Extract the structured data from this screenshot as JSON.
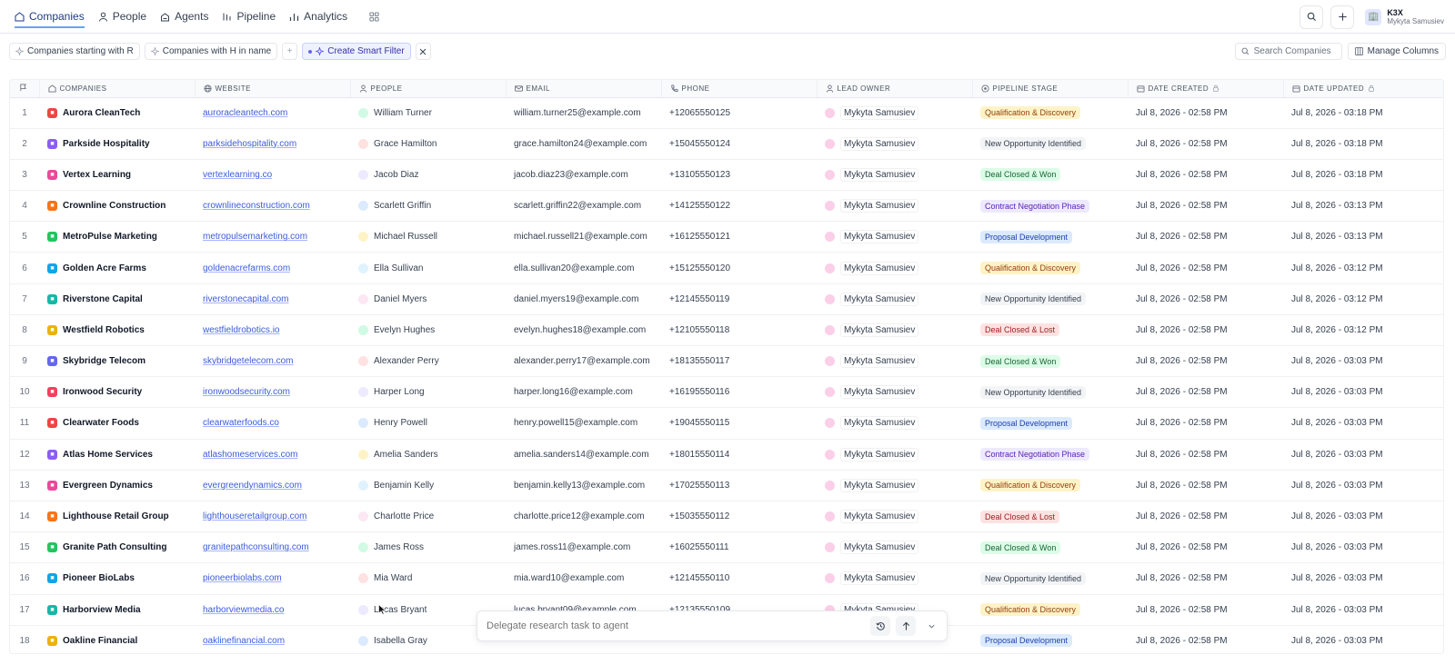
{
  "nav": {
    "items": [
      {
        "label": "Companies",
        "icon": "building-icon",
        "active": true
      },
      {
        "label": "People",
        "icon": "person-icon",
        "active": false
      },
      {
        "label": "Agents",
        "icon": "agent-icon",
        "active": false
      },
      {
        "label": "Pipeline",
        "icon": "pipeline-icon",
        "active": false
      },
      {
        "label": "Analytics",
        "icon": "chart-icon",
        "active": false
      }
    ]
  },
  "user": {
    "org": "K3X",
    "name": "Mykyta Samusiev"
  },
  "filters": {
    "chips": [
      "Companies starting with R",
      "Companies with H in name"
    ],
    "smart_filter_label": "Create Smart Filter",
    "search_placeholder": "Search Companies",
    "manage_columns_label": "Manage Columns"
  },
  "table": {
    "columns": [
      "COMPANIES",
      "WEBSITE",
      "PEOPLE",
      "EMAIL",
      "PHONE",
      "LEAD OWNER",
      "PIPELINE STAGE",
      "DATE CREATED",
      "DATE UPDATED"
    ],
    "rows": [
      {
        "n": "1",
        "company": "Aurora CleanTech",
        "website": "auroracleantech.com",
        "person": "William Turner",
        "email": "william.turner25@example.com",
        "phone": "+12065550125",
        "owner": "Mykyta Samusiev",
        "stage": "Qualification & Discovery",
        "created": "Jul 8, 2026 - 02:58 PM",
        "updated": "Jul 8, 2026 - 03:18 PM"
      },
      {
        "n": "2",
        "company": "Parkside Hospitality",
        "website": "parksidehospitality.com",
        "person": "Grace Hamilton",
        "email": "grace.hamilton24@example.com",
        "phone": "+15045550124",
        "owner": "Mykyta Samusiev",
        "stage": "New Opportunity Identified",
        "created": "Jul 8, 2026 - 02:58 PM",
        "updated": "Jul 8, 2026 - 03:18 PM"
      },
      {
        "n": "3",
        "company": "Vertex Learning",
        "website": "vertexlearning.co",
        "person": "Jacob Diaz",
        "email": "jacob.diaz23@example.com",
        "phone": "+13105550123",
        "owner": "Mykyta Samusiev",
        "stage": "Deal Closed & Won",
        "created": "Jul 8, 2026 - 02:58 PM",
        "updated": "Jul 8, 2026 - 03:18 PM"
      },
      {
        "n": "4",
        "company": "Crownline Construction",
        "website": "crownlineconstruction.com",
        "person": "Scarlett Griffin",
        "email": "scarlett.griffin22@example.com",
        "phone": "+14125550122",
        "owner": "Mykyta Samusiev",
        "stage": "Contract Negotiation Phase",
        "created": "Jul 8, 2026 - 02:58 PM",
        "updated": "Jul 8, 2026 - 03:13 PM"
      },
      {
        "n": "5",
        "company": "MetroPulse Marketing",
        "website": "metropulsemarketing.com",
        "person": "Michael Russell",
        "email": "michael.russell21@example.com",
        "phone": "+16125550121",
        "owner": "Mykyta Samusiev",
        "stage": "Proposal Development",
        "created": "Jul 8, 2026 - 02:58 PM",
        "updated": "Jul 8, 2026 - 03:13 PM"
      },
      {
        "n": "6",
        "company": "Golden Acre Farms",
        "website": "goldenacrefarms.com",
        "person": "Ella Sullivan",
        "email": "ella.sullivan20@example.com",
        "phone": "+15125550120",
        "owner": "Mykyta Samusiev",
        "stage": "Qualification & Discovery",
        "created": "Jul 8, 2026 - 02:58 PM",
        "updated": "Jul 8, 2026 - 03:12 PM"
      },
      {
        "n": "7",
        "company": "Riverstone Capital",
        "website": "riverstonecapital.com",
        "person": "Daniel Myers",
        "email": "daniel.myers19@example.com",
        "phone": "+12145550119",
        "owner": "Mykyta Samusiev",
        "stage": "New Opportunity Identified",
        "created": "Jul 8, 2026 - 02:58 PM",
        "updated": "Jul 8, 2026 - 03:12 PM"
      },
      {
        "n": "8",
        "company": "Westfield Robotics",
        "website": "westfieldrobotics.io",
        "person": "Evelyn Hughes",
        "email": "evelyn.hughes18@example.com",
        "phone": "+12105550118",
        "owner": "Mykyta Samusiev",
        "stage": "Deal Closed & Lost",
        "created": "Jul 8, 2026 - 02:58 PM",
        "updated": "Jul 8, 2026 - 03:12 PM"
      },
      {
        "n": "9",
        "company": "Skybridge Telecom",
        "website": "skybridgetelecom.com",
        "person": "Alexander Perry",
        "email": "alexander.perry17@example.com",
        "phone": "+18135550117",
        "owner": "Mykyta Samusiev",
        "stage": "Deal Closed & Won",
        "created": "Jul 8, 2026 - 02:58 PM",
        "updated": "Jul 8, 2026 - 03:03 PM"
      },
      {
        "n": "10",
        "company": "Ironwood Security",
        "website": "ironwoodsecurity.com",
        "person": "Harper Long",
        "email": "harper.long16@example.com",
        "phone": "+16195550116",
        "owner": "Mykyta Samusiev",
        "stage": "New Opportunity Identified",
        "created": "Jul 8, 2026 - 02:58 PM",
        "updated": "Jul 8, 2026 - 03:03 PM"
      },
      {
        "n": "11",
        "company": "Clearwater Foods",
        "website": "clearwaterfoods.co",
        "person": "Henry Powell",
        "email": "henry.powell15@example.com",
        "phone": "+19045550115",
        "owner": "Mykyta Samusiev",
        "stage": "Proposal Development",
        "created": "Jul 8, 2026 - 02:58 PM",
        "updated": "Jul 8, 2026 - 03:03 PM"
      },
      {
        "n": "12",
        "company": "Atlas Home Services",
        "website": "atlashomeservices.com",
        "person": "Amelia Sanders",
        "email": "amelia.sanders14@example.com",
        "phone": "+18015550114",
        "owner": "Mykyta Samusiev",
        "stage": "Contract Negotiation Phase",
        "created": "Jul 8, 2026 - 02:58 PM",
        "updated": "Jul 8, 2026 - 03:03 PM"
      },
      {
        "n": "13",
        "company": "Evergreen Dynamics",
        "website": "evergreendynamics.com",
        "person": "Benjamin Kelly",
        "email": "benjamin.kelly13@example.com",
        "phone": "+17025550113",
        "owner": "Mykyta Samusiev",
        "stage": "Qualification & Discovery",
        "created": "Jul 8, 2026 - 02:58 PM",
        "updated": "Jul 8, 2026 - 03:03 PM"
      },
      {
        "n": "14",
        "company": "Lighthouse Retail Group",
        "website": "lighthouseretailgroup.com",
        "person": "Charlotte Price",
        "email": "charlotte.price12@example.com",
        "phone": "+15035550112",
        "owner": "Mykyta Samusiev",
        "stage": "Deal Closed & Lost",
        "created": "Jul 8, 2026 - 02:58 PM",
        "updated": "Jul 8, 2026 - 03:03 PM"
      },
      {
        "n": "15",
        "company": "Granite Path Consulting",
        "website": "granitepathconsulting.com",
        "person": "James Ross",
        "email": "james.ross11@example.com",
        "phone": "+16025550111",
        "owner": "Mykyta Samusiev",
        "stage": "Deal Closed & Won",
        "created": "Jul 8, 2026 - 02:58 PM",
        "updated": "Jul 8, 2026 - 03:03 PM"
      },
      {
        "n": "16",
        "company": "Pioneer BioLabs",
        "website": "pioneerbiolabs.com",
        "person": "Mia Ward",
        "email": "mia.ward10@example.com",
        "phone": "+12145550110",
        "owner": "Mykyta Samusiev",
        "stage": "New Opportunity Identified",
        "created": "Jul 8, 2026 - 02:58 PM",
        "updated": "Jul 8, 2026 - 03:03 PM"
      },
      {
        "n": "17",
        "company": "Harborview Media",
        "website": "harborviewmedia.co",
        "person": "Lucas Bryant",
        "email": "lucas.bryant09@example.com",
        "phone": "+12135550109",
        "owner": "Mykyta Samusiev",
        "stage": "Qualification & Discovery",
        "created": "Jul 8, 2026 - 02:58 PM",
        "updated": "Jul 8, 2026 - 03:03 PM"
      },
      {
        "n": "18",
        "company": "Oakline Financial",
        "website": "oaklinefinancial.com",
        "person": "Isabella Gray",
        "email": "",
        "phone": "",
        "owner": "",
        "stage": "Proposal Development",
        "created": "Jul 8, 2026 - 02:58 PM",
        "updated": "Jul 8, 2026 - 03:03 PM"
      }
    ]
  },
  "stage_colors": {
    "Qualification & Discovery": {
      "bg": "#fef3c7",
      "fg": "#92400e"
    },
    "New Opportunity Identified": {
      "bg": "#f3f4f6",
      "fg": "#374151"
    },
    "Deal Closed & Won": {
      "bg": "#dcfce7",
      "fg": "#166534"
    },
    "Contract Negotiation Phase": {
      "bg": "#ede9fe",
      "fg": "#5b21b6"
    },
    "Proposal Development": {
      "bg": "#dbeafe",
      "fg": "#1e40af"
    },
    "Deal Closed & Lost": {
      "bg": "#fee2e2",
      "fg": "#991b1b"
    }
  },
  "agent": {
    "placeholder": "Delegate research task to agent"
  }
}
